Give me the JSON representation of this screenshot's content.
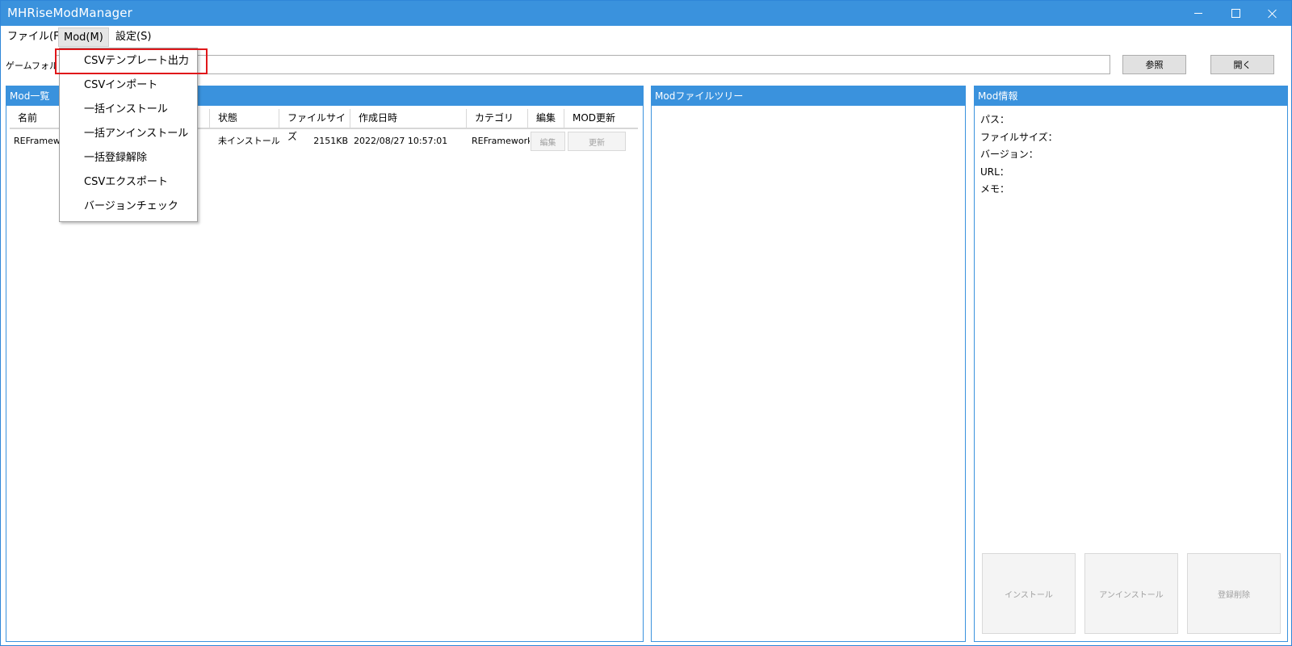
{
  "window": {
    "title": "MHRiseModManager"
  },
  "menubar": {
    "file": "ファイル(F)",
    "mod": "Mod(M)",
    "settings": "設定(S)"
  },
  "folder": {
    "label": "ゲームフォルダ",
    "value": "",
    "browse_label": "参照",
    "open_label": "開く"
  },
  "modlist": {
    "header": "Mod一覧",
    "columns": [
      "名前",
      "状態",
      "ファイルサイズ",
      "作成日時",
      "カテゴリ",
      "編集",
      "MOD更新"
    ],
    "rows": [
      {
        "name": "REFramework",
        "status": "未インストール",
        "size": "2151KB",
        "created": "2022/08/27 10:57:01",
        "category": "REFramework",
        "edit_label": "編集",
        "update_label": "更新"
      }
    ]
  },
  "tree": {
    "header": "Modファイルツリー"
  },
  "info": {
    "header": "Mod情報",
    "path_label": "パス：",
    "size_label": "ファイルサイズ：",
    "version_label": "バージョン：",
    "url_label": "URL：",
    "memo_label": "メモ：",
    "install_label": "インストール",
    "uninstall_label": "アンインストール",
    "delete_label": "登録削除"
  },
  "mod_menu": {
    "items": [
      "CSVテンプレート出力",
      "CSVインポート",
      "一括インストール",
      "一括アンインストール",
      "一括登録解除",
      "CSVエクスポート",
      "バージョンチェック"
    ],
    "highlighted_index": 0,
    "highlight_color": "#e0171a"
  },
  "colors": {
    "accent": "#3a92dd"
  }
}
